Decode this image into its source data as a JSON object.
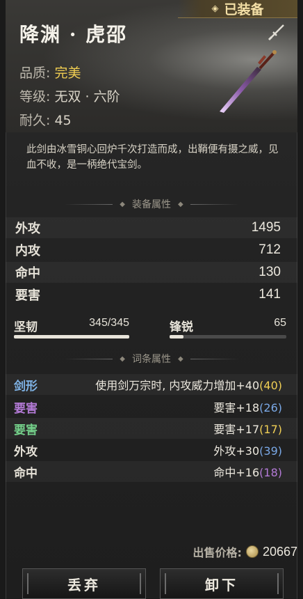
{
  "header": {
    "equipped_label": "已装备",
    "name": "降渊 · 虎邵",
    "quality_label": "品质:",
    "quality_value": "完美",
    "level_label": "等级:",
    "level_value": "无双 · 六阶",
    "durability_label": "耐久:",
    "durability_value": "45"
  },
  "description": "此剑由冰雪铜心回炉千次打造而成，出鞘便有摄之威，见血不收，是一柄绝代宝剑。",
  "equip_attrs": {
    "title": "装备属性",
    "rows": [
      {
        "label": "外攻",
        "value": "1495"
      },
      {
        "label": "内攻",
        "value": "712"
      },
      {
        "label": "命中",
        "value": "130"
      },
      {
        "label": "要害",
        "value": "141"
      }
    ],
    "bars": [
      {
        "label": "坚韧",
        "value": "345/345",
        "fill": 1.0
      },
      {
        "label": "锋锐",
        "value": "65",
        "fill": 0.12
      }
    ]
  },
  "affix_attrs": {
    "title": "词条属性",
    "rows": [
      {
        "label": "剑形",
        "label_color": "#7fb3e6",
        "desc": "使用剑万宗时, 内攻威力增加+40",
        "bonus": "40",
        "bonus_color": "#f0cf55"
      },
      {
        "label": "要害",
        "label_color": "#b37ad6",
        "desc": "要害+18",
        "bonus": "26",
        "bonus_color": "#7aa8e6"
      },
      {
        "label": "要害",
        "label_color": "#74d08a",
        "desc": "要害+17",
        "bonus": "17",
        "bonus_color": "#f0cf55"
      },
      {
        "label": "外攻",
        "label_color": "#e6e2d8",
        "desc": "外攻+30",
        "bonus": "39",
        "bonus_color": "#7aa8e6"
      },
      {
        "label": "命中",
        "label_color": "#e6e2d8",
        "desc": "命中+16",
        "bonus": "18",
        "bonus_color": "#b37ad6"
      }
    ]
  },
  "sell": {
    "label": "出售价格:",
    "value": "20667"
  },
  "buttons": {
    "discard": "丢弃",
    "unequip": "卸下"
  }
}
